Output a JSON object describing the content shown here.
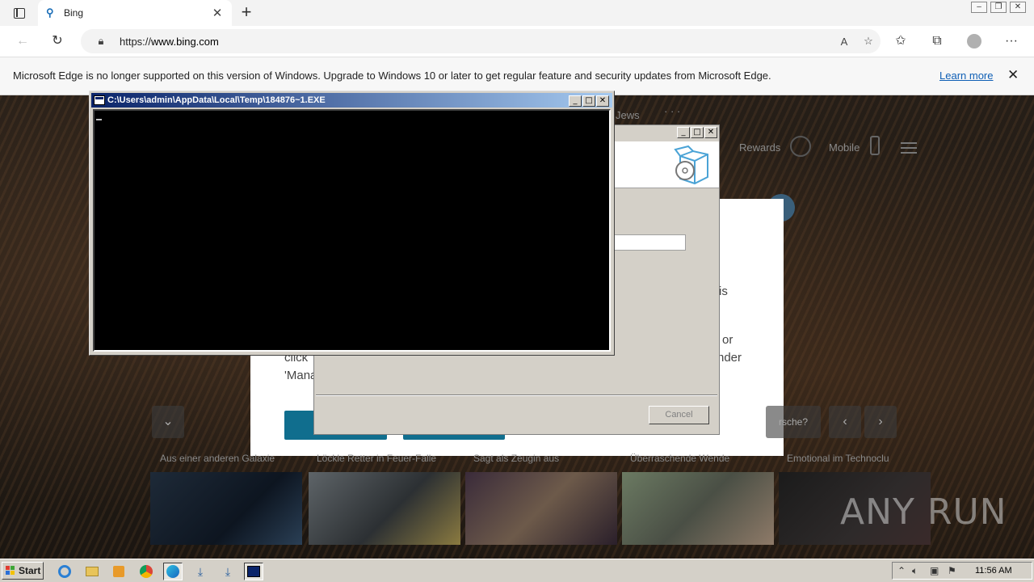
{
  "browser": {
    "tab_title": "Bing",
    "url_prefix": "https://",
    "url_host": "www.bing.com",
    "infobar_message": "Microsoft Edge is no longer supported on this version of Windows. Upgrade to Windows 10 or later to get regular feature and security updates from Microsoft Edge.",
    "infobar_link": "Learn more"
  },
  "bing": {
    "nav_partial": "Jews",
    "nav_more": "· · ·",
    "rewards": "Rewards",
    "mobile": "Mobile",
    "consent_fragments": {
      "is": "is",
      "or": "or",
      "click": "click",
      "nder": "nder",
      "mana": "'Mana"
    },
    "news_search_partial": "rsche?",
    "news_titles": [
      "Aus einer anderen Galaxie",
      "Löckle Retter in Feuer-Falle",
      "Sagt als Zeugin aus",
      "Überraschende Wende",
      "Emotional im Technoclu"
    ]
  },
  "console": {
    "title": "C:\\Users\\admin\\AppData\\Local\\Temp\\184876~1.EXE"
  },
  "setup": {
    "cancel_label": "Cancel"
  },
  "watermark": "ANY RUN",
  "taskbar": {
    "start_label": "Start",
    "clock": "11:56 AM"
  }
}
